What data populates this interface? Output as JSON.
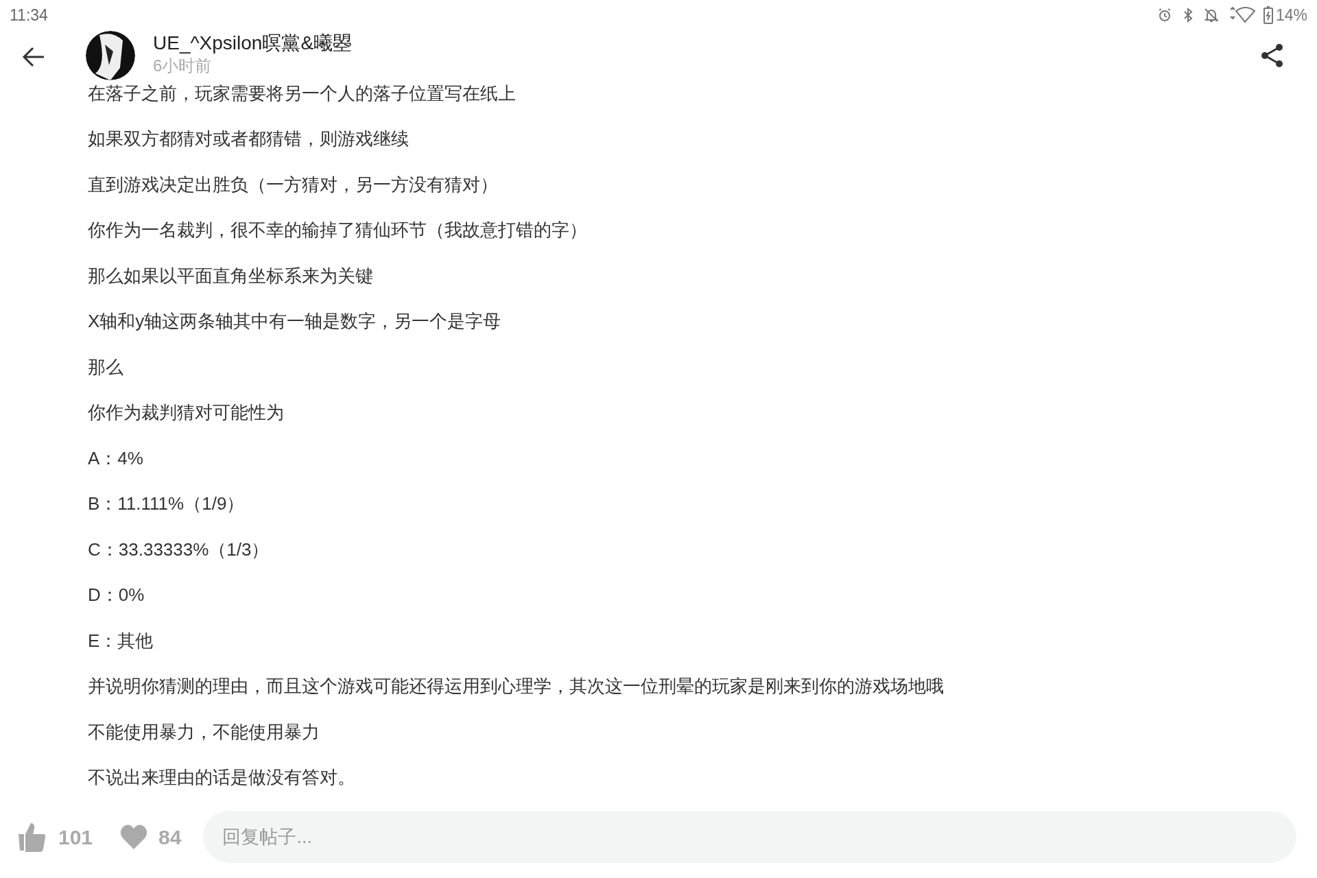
{
  "status_bar": {
    "time": "11:34",
    "battery": "14%"
  },
  "header": {
    "author": "UE_^Xpsilon暝黨&曦曌",
    "posted": "6小时前"
  },
  "post": {
    "lines": [
      "在落子之前，玩家需要将另一个人的落子位置写在纸上",
      "如果双方都猜对或者都猜错，则游戏继续",
      "直到游戏决定出胜负（一方猜对，另一方没有猜对）",
      "你作为一名裁判，很不幸的输掉了猜仙环节（我故意打错的字）",
      "那么如果以平面直角坐标系来为关键",
      "X轴和y轴这两条轴其中有一轴是数字，另一个是字母",
      "那么",
      "你作为裁判猜对可能性为",
      "A：4%",
      "B：11.111%（1/9）",
      "C：33.33333%（1/3）",
      "D：0%",
      "E：其他",
      "并说明你猜测的理由，而且这个游戏可能还得运用到心理学，其次这一位刑晕的玩家是刚来到你的游戏场地哦",
      "不能使用暴力，不能使用暴力",
      "不说出来理由的话是做没有答对。"
    ]
  },
  "bottom_bar": {
    "likes": "101",
    "favorites": "84",
    "reply": {
      "placeholder": "回复帖子..."
    }
  }
}
